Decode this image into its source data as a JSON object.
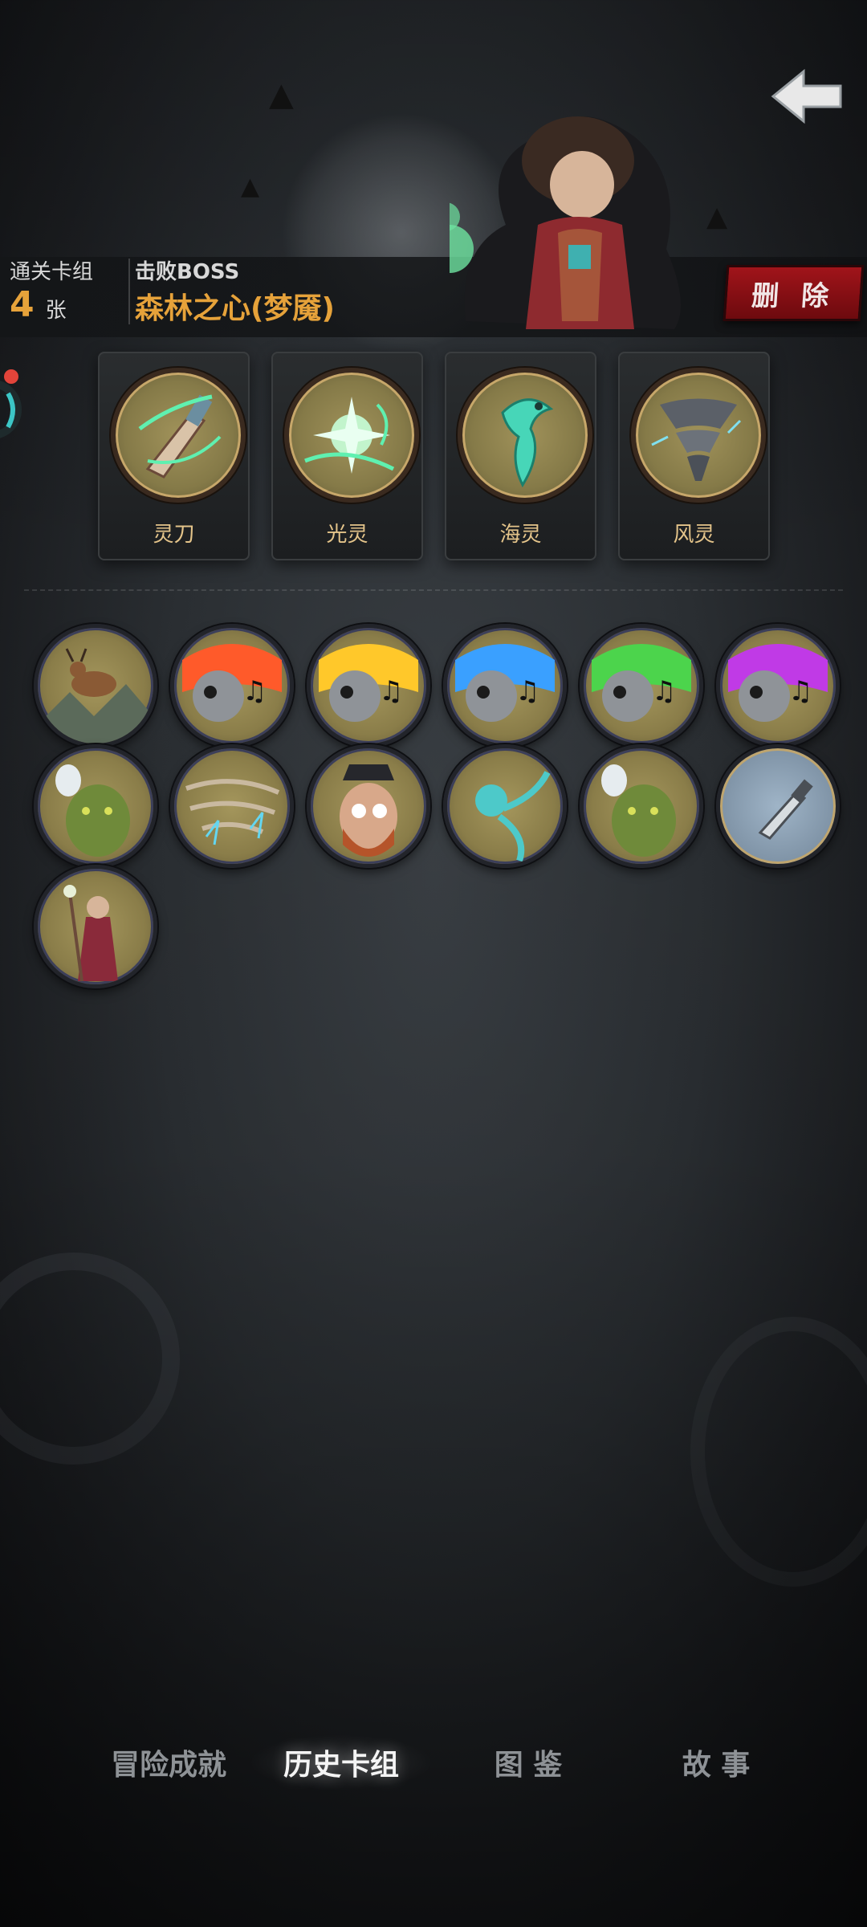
{
  "header": {
    "clear_deck_label": "通关卡组",
    "card_count": "4",
    "card_unit": "张",
    "defeated_boss_label": "击败BOSS",
    "boss_name": "森林之心(梦魇)",
    "delete_label": "删 除",
    "back_icon": "back-arrow-icon"
  },
  "skills": [
    {
      "label": "灵刀",
      "icon": "spirit-blade-icon"
    },
    {
      "label": "光灵",
      "icon": "light-spirit-icon"
    },
    {
      "label": "海灵",
      "icon": "sea-spirit-icon"
    },
    {
      "label": "风灵",
      "icon": "wind-spirit-icon"
    }
  ],
  "cards": [
    {
      "icon": "deer-card-icon"
    },
    {
      "icon": "skull-music-red-card-icon"
    },
    {
      "icon": "skull-music-yellow-card-icon"
    },
    {
      "icon": "skull-music-blue-card-icon"
    },
    {
      "icon": "skull-music-green-card-icon"
    },
    {
      "icon": "skull-music-purple-card-icon"
    },
    {
      "icon": "ogre-ghost-card-icon"
    },
    {
      "icon": "whirlwind-card-icon"
    },
    {
      "icon": "pirate-captain-card-icon"
    },
    {
      "icon": "water-spirit-card-icon"
    },
    {
      "icon": "ogre-ghost-card-icon"
    },
    {
      "icon": "knife-card-icon"
    },
    {
      "icon": "forest-mage-card-icon"
    }
  ],
  "tabs": [
    {
      "label": "冒险成就",
      "active": false
    },
    {
      "label": "历史卡组",
      "active": true
    },
    {
      "label": "图 鉴",
      "active": false
    },
    {
      "label": "故 事",
      "active": false
    }
  ],
  "colors": {
    "accent": "#e6a23a",
    "delete_bg": "#8b0f14",
    "skill_label": "#e4c48a"
  }
}
